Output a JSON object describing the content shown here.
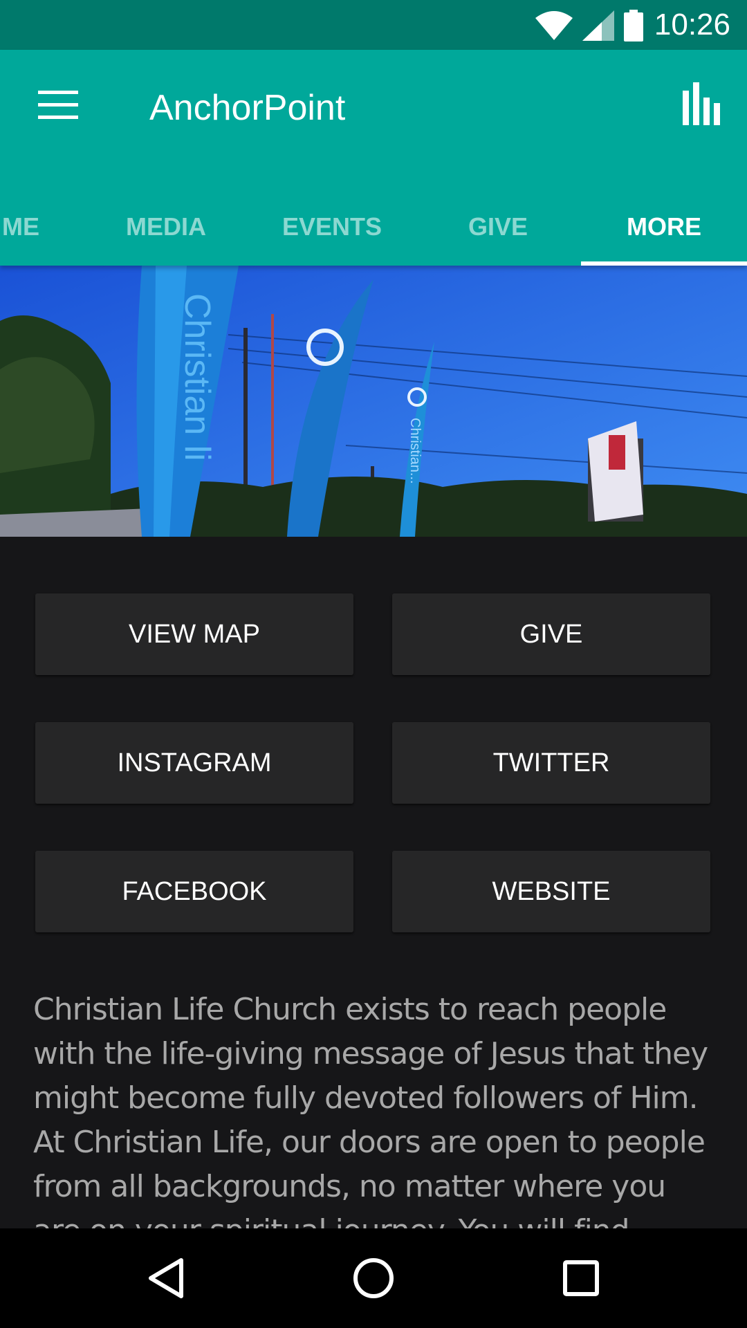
{
  "status_bar": {
    "time": "10:26",
    "icons": [
      "wifi-icon",
      "cell-signal-icon",
      "battery-icon"
    ]
  },
  "app_bar": {
    "title": "AnchorPoint",
    "menu_icon": "hamburger-menu-icon",
    "action_icon": "bar-chart-icon",
    "color": "#00a89a"
  },
  "tabs": {
    "items": [
      {
        "label": "ME"
      },
      {
        "label": "MEDIA"
      },
      {
        "label": "EVENTS"
      },
      {
        "label": "GIVE"
      },
      {
        "label": "MORE"
      }
    ],
    "active": "MORE"
  },
  "hero": {
    "flag_text_1": "Christian li",
    "flag_text_2": "Christian..."
  },
  "buttons": {
    "view_map": "VIEW MAP",
    "give": "GIVE",
    "instagram": "INSTAGRAM",
    "twitter": "TWITTER",
    "facebook": "FACEBOOK",
    "website": "WEBSITE"
  },
  "description": "Christian Life Church exists to reach people with the life-giving message of Jesus that they might become fully devoted followers of Him. At Christian Life, our doors are open to people from all backgrounds, no matter where you are on your spiritual journey. You will find Christian",
  "nav_bar": {
    "icons": [
      "back-icon",
      "home-icon",
      "recents-icon"
    ]
  }
}
